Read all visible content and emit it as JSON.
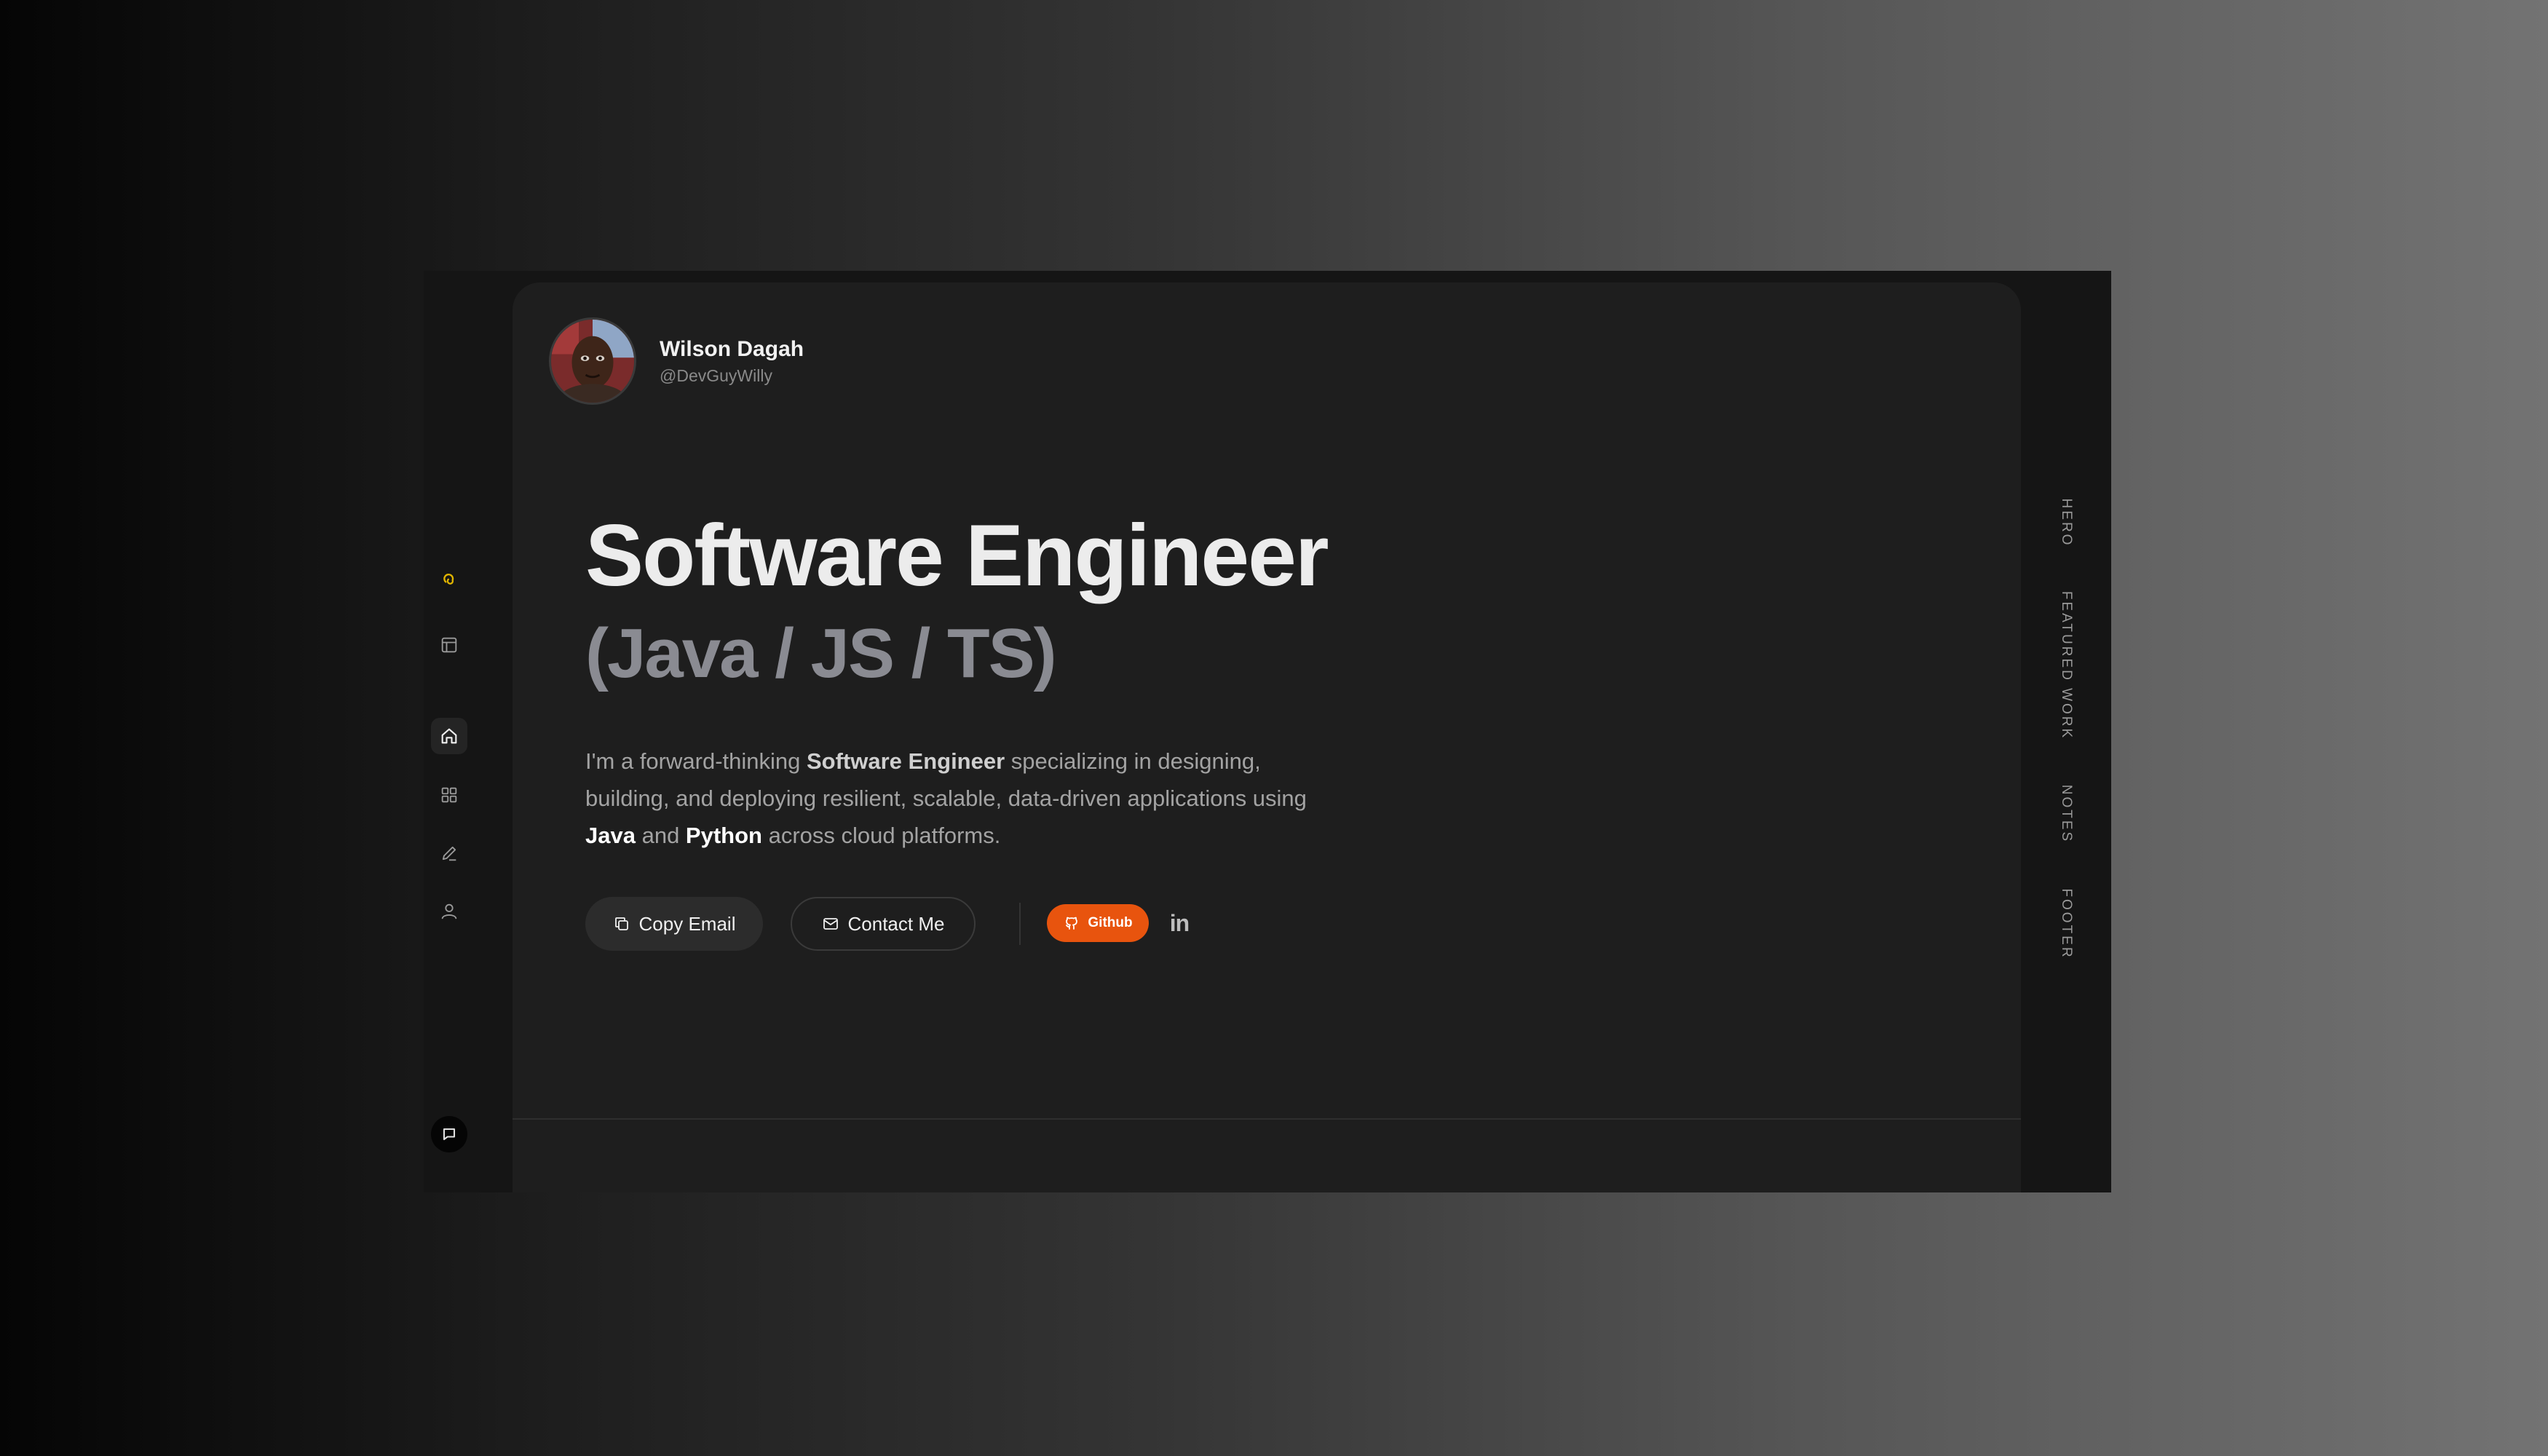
{
  "sidebar": {
    "items": [
      {
        "name": "logo",
        "icon": "spiral-logo-icon"
      },
      {
        "name": "layout",
        "icon": "layout-panel-icon"
      },
      {
        "name": "home",
        "icon": "home-icon",
        "active": true
      },
      {
        "name": "projects",
        "icon": "grid-icon"
      },
      {
        "name": "notes",
        "icon": "pen-icon"
      },
      {
        "name": "about",
        "icon": "user-icon"
      }
    ],
    "chat_icon": "chat-icon"
  },
  "profile": {
    "name": "Wilson Dagah",
    "handle": "@DevGuyWilly"
  },
  "hero": {
    "title": "Software Engineer",
    "subtitle": "(Java / JS / TS)",
    "description": {
      "part1": "I'm a forward-thinking ",
      "strong1": "Software Engineer",
      "part2": " specializing in designing, building, and deploying resilient, scalable, data-driven applications using ",
      "strong2": "Java",
      "part3": " and ",
      "strong3": "Python",
      "part4": " across cloud platforms."
    }
  },
  "actions": {
    "copy_email": "Copy Email",
    "contact_me": "Contact Me",
    "github": "Github",
    "linkedin": "in"
  },
  "section_nav": [
    "HERO",
    "FEATURED WORK",
    "NOTES",
    "FOOTER"
  ],
  "colors": {
    "accent": "#e8540e",
    "logo_yellow": "#e0b400",
    "card_bg": "#1e1e1e",
    "frame_bg": "#151515"
  }
}
